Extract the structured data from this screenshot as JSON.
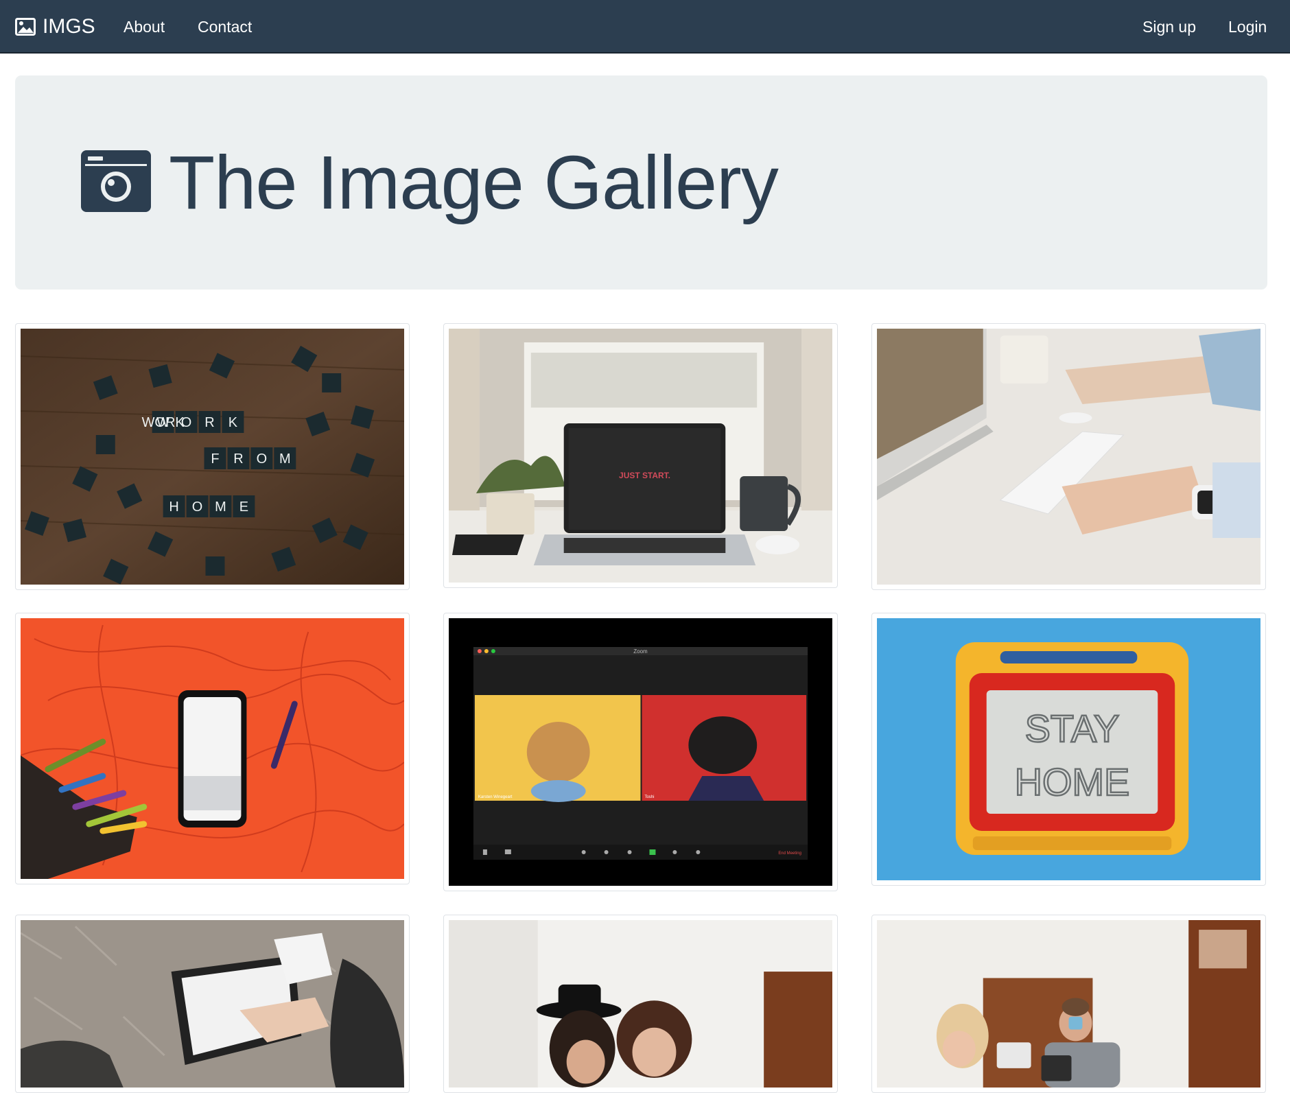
{
  "nav": {
    "brand": "IMGS",
    "brand_icon": "image-icon",
    "links": [
      "About",
      "Contact"
    ],
    "right_links": [
      "Sign up",
      "Login"
    ]
  },
  "hero": {
    "title": "The Image Gallery",
    "icon": "camera-icon"
  },
  "colors": {
    "navbar": "#2c3e50",
    "jumbotron": "#ecf0f1",
    "text": "#2c3e50"
  },
  "gallery": {
    "photos": [
      {
        "id": "scrabble-tiles-work-from-home",
        "tiles": [
          "WORK",
          "FROM",
          "HOME"
        ]
      },
      {
        "id": "laptop-by-window",
        "screen_text": "JUST START."
      },
      {
        "id": "typing-on-keyboard"
      },
      {
        "id": "phone-with-crayons"
      },
      {
        "id": "zoom-call-dogs",
        "window_title": "Zoom",
        "participants": [
          "Karsten Winegeart",
          "Toshi"
        ],
        "end_label": "End Meeting"
      },
      {
        "id": "stay-home-drawing-board",
        "board_text": [
          "STAY",
          "HOME"
        ]
      },
      {
        "id": "tablet-on-fur-rug"
      },
      {
        "id": "two-women-laptop"
      },
      {
        "id": "couple-working-table"
      }
    ]
  }
}
